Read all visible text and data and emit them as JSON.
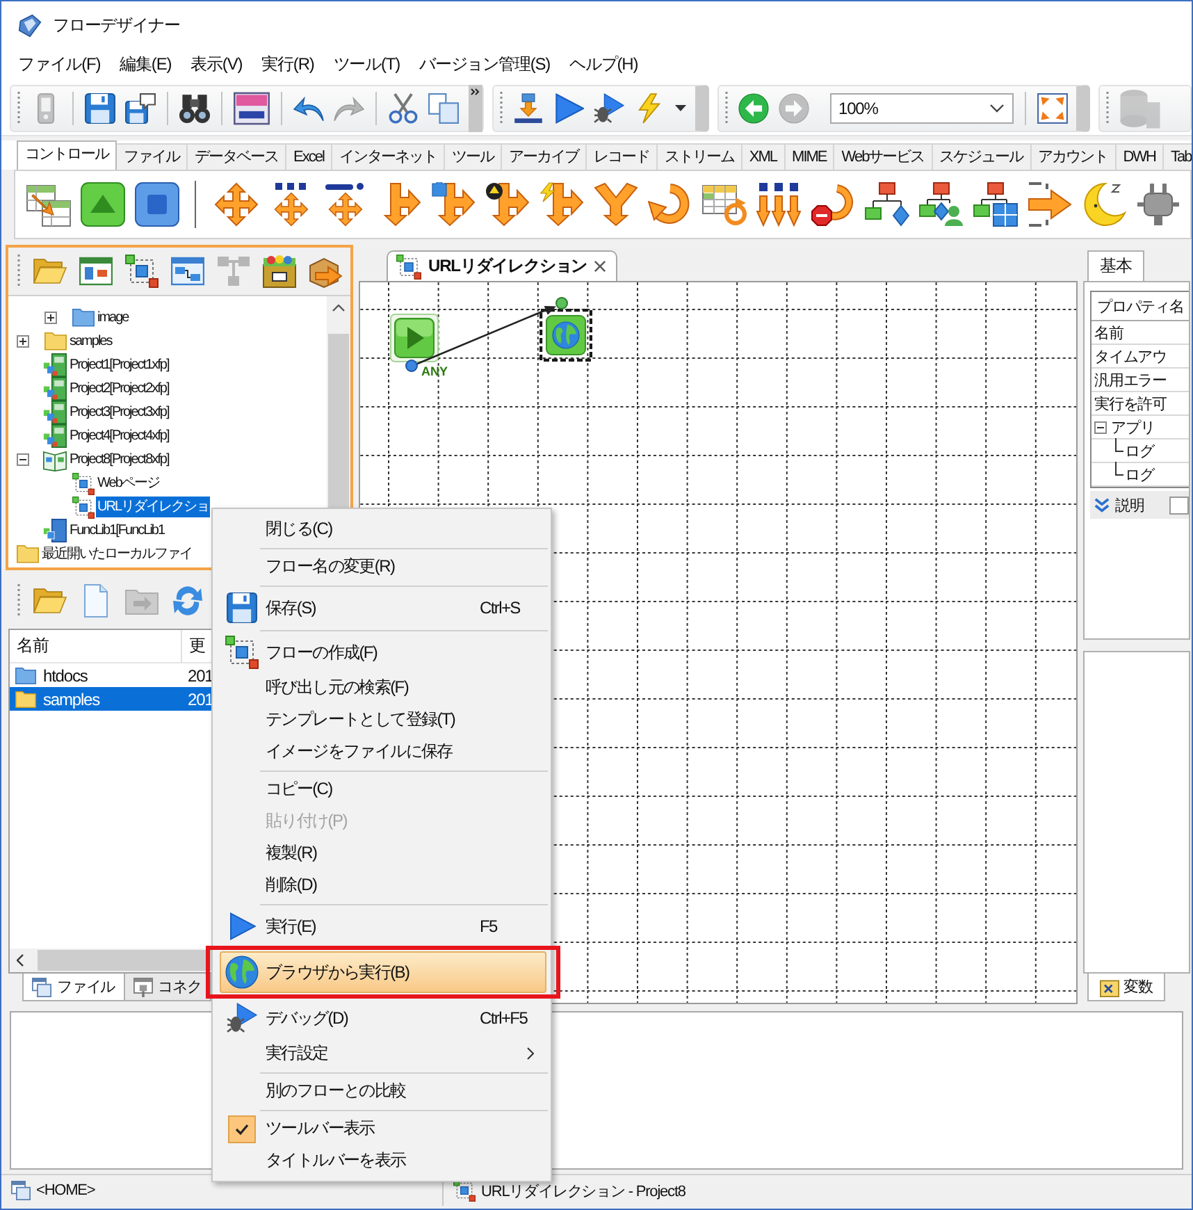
{
  "window": {
    "title": "フローデザイナー"
  },
  "menu_bar": [
    "ファイル(F)",
    "編集(E)",
    "表示(V)",
    "実行(R)",
    "ツール(T)",
    "バージョン管理(S)",
    "ヘルプ(H)"
  ],
  "toolbar": {
    "buttons": [
      {
        "disabled": true
      },
      {
        "disabled": false
      },
      {
        "disabled": false
      },
      {
        "disabled": false
      },
      {
        "disabled": false
      },
      {
        "disabled": false
      },
      {
        "disabled": true
      },
      {
        "disabled": false
      },
      {
        "disabled": false
      },
      {
        "disabled": false
      },
      {
        "disabled": false
      },
      {
        "disabled": false
      },
      {
        "disabled": false
      },
      {
        "disabled": false
      },
      {
        "disabled": false
      },
      {
        "disabled": true
      },
      {
        "disabled": false
      },
      {
        "disabled": true
      }
    ],
    "zoom": "100%"
  },
  "palette": {
    "tabs": [
      {
        "label": "コントロール",
        "selected": true
      },
      {
        "label": "ファイル",
        "selected": false
      },
      {
        "label": "データベース",
        "selected": false
      },
      {
        "label": "Excel",
        "selected": false
      },
      {
        "label": "インターネット",
        "selected": false
      },
      {
        "label": "ツール",
        "selected": false
      },
      {
        "label": "アーカイブ",
        "selected": false
      },
      {
        "label": "レコード",
        "selected": false
      },
      {
        "label": "ストリーム",
        "selected": false
      },
      {
        "label": "XML",
        "selected": false
      },
      {
        "label": "MIME",
        "selected": false
      },
      {
        "label": "Webサービス",
        "selected": false
      },
      {
        "label": "スケジュール",
        "selected": false
      },
      {
        "label": "アカウント",
        "selected": false
      },
      {
        "label": "DWH",
        "selected": false
      },
      {
        "label": "Tab",
        "selected": false
      }
    ]
  },
  "project_panel": {
    "toolbar": [
      {
        "disabled": false
      },
      {
        "disabled": false
      },
      {
        "disabled": false
      },
      {
        "disabled": false
      },
      {
        "disabled": true
      },
      {
        "disabled": false
      },
      {
        "disabled": false
      }
    ],
    "tree": [
      {
        "children": [
          {
            "children": [
              {
                "label": "image",
                "kind": "webroot",
                "expanded": false,
                "selected": false
              }
            ]
          },
          {
            "label": "samples",
            "kind": "folder",
            "expanded": false,
            "selected": false
          },
          {
            "label": "Project1[Project1xfp]",
            "kind": "project",
            "selected": false
          },
          {
            "label": "Project2[Project2xfp]",
            "kind": "project",
            "selected": false
          },
          {
            "label": "Project3[Project3xfp]",
            "kind": "project",
            "selected": false
          },
          {
            "label": "Project4[Project4xfp]",
            "kind": "project",
            "selected": false
          },
          {
            "label": "Project8[Project8xfp]",
            "kind": "open-project",
            "expanded": true,
            "selected": false,
            "children": [
              {
                "label": "Webページ",
                "kind": "flow",
                "selected": false
              },
              {
                "label": "URLリダイレクショ",
                "kind": "flow",
                "selected": true
              }
            ]
          },
          {
            "label": "FuncLib1[FuncLib1",
            "kind": "library",
            "selected": false
          }
        ]
      },
      {
        "label": "最近開いたローカルファイ",
        "kind": "folder",
        "selected": false
      }
    ]
  },
  "file_panel": {
    "toolbar": [
      {
        "disabled": false
      },
      {
        "disabled": false
      },
      {
        "disabled": true
      },
      {
        "disabled": false
      }
    ],
    "columns": [
      "名前",
      "更"
    ],
    "rows": [
      {
        "kind": "webroot",
        "name": "htdocs",
        "modified": "201",
        "selected": false
      },
      {
        "kind": "folder",
        "name": "samples",
        "modified": "201",
        "selected": true
      }
    ],
    "tabs": [
      {
        "label": "ファイル",
        "selected": true
      },
      {
        "label": "コネク",
        "selected": false
      }
    ]
  },
  "editor": {
    "tabs": [
      {
        "label": "URLリダイレクション",
        "selected": true
      }
    ],
    "canvas": {
      "nodes": [
        {
          "kind": "start",
          "port_label": "ANY",
          "selected": false
        },
        {
          "kind": "browser",
          "selected": true
        }
      ]
    }
  },
  "properties": {
    "tabs": [
      {
        "label": "基本",
        "selected": true
      }
    ],
    "header": "プロパティ名",
    "rows": [
      {
        "label": "名前"
      },
      {
        "label": "タイムアウ"
      },
      {
        "label": "汎用エラー"
      },
      {
        "label": "実行を許可"
      },
      {
        "label": "アプリ",
        "expanded": true,
        "children": [
          {
            "label": "ログ"
          },
          {
            "label": "ログ"
          }
        ]
      }
    ],
    "description": "説明",
    "bottom_tabs": [
      {
        "label": "変数",
        "selected": true
      }
    ]
  },
  "context_menu": {
    "items": [
      {
        "kind": "item",
        "label": "閉じる(C)",
        "disabled": false,
        "highlighted": false,
        "annotated": false
      },
      {
        "kind": "separator"
      },
      {
        "kind": "item",
        "label": "フロー名の変更(R)",
        "disabled": false,
        "highlighted": false,
        "annotated": false
      },
      {
        "kind": "separator"
      },
      {
        "kind": "item",
        "label": "保存(S)",
        "shortcut": "Ctrl+S",
        "disabled": false,
        "highlighted": false,
        "annotated": false
      },
      {
        "kind": "separator"
      },
      {
        "kind": "item",
        "label": "フローの作成(F)",
        "disabled": false,
        "highlighted": false,
        "annotated": false
      },
      {
        "kind": "item",
        "label": "呼び出し元の検索(F)",
        "disabled": false,
        "highlighted": false,
        "annotated": false
      },
      {
        "kind": "item",
        "label": "テンプレートとして登録(T)",
        "disabled": false,
        "highlighted": false,
        "annotated": false
      },
      {
        "kind": "item",
        "label": "イメージをファイルに保存",
        "disabled": false,
        "highlighted": false,
        "annotated": false
      },
      {
        "kind": "separator"
      },
      {
        "kind": "item",
        "label": "コピー(C)",
        "disabled": false,
        "highlighted": false,
        "annotated": false
      },
      {
        "kind": "item",
        "label": "貼り付け(P)",
        "disabled": true,
        "highlighted": false,
        "annotated": false
      },
      {
        "kind": "item",
        "label": "複製(R)",
        "disabled": false,
        "highlighted": false,
        "annotated": false
      },
      {
        "kind": "item",
        "label": "削除(D)",
        "disabled": false,
        "highlighted": false,
        "annotated": false
      },
      {
        "kind": "separator"
      },
      {
        "kind": "item",
        "label": "実行(E)",
        "shortcut": "F5",
        "disabled": false,
        "highlighted": false,
        "annotated": false
      },
      {
        "kind": "item",
        "label": "ブラウザから実行(B)",
        "disabled": false,
        "highlighted": true,
        "annotated": true
      },
      {
        "kind": "item",
        "label": "デバッグ(D)",
        "shortcut": "Ctrl+F5",
        "disabled": false,
        "highlighted": false,
        "annotated": false
      },
      {
        "kind": "submenu",
        "label": "実行設定",
        "disabled": false,
        "highlighted": false,
        "annotated": false
      },
      {
        "kind": "separator"
      },
      {
        "kind": "item",
        "label": "別のフローとの比較",
        "disabled": false,
        "highlighted": false,
        "annotated": false
      },
      {
        "kind": "separator"
      },
      {
        "kind": "check",
        "label": "ツールバー表示",
        "checked": true,
        "disabled": false,
        "highlighted": false,
        "annotated": false
      },
      {
        "kind": "check",
        "label": "タイトルバーを表示",
        "checked": false,
        "disabled": false,
        "highlighted": false,
        "annotated": false
      }
    ]
  },
  "status_bar": {
    "location": "<HOME>",
    "document": "URLリダイレクション - Project8"
  }
}
